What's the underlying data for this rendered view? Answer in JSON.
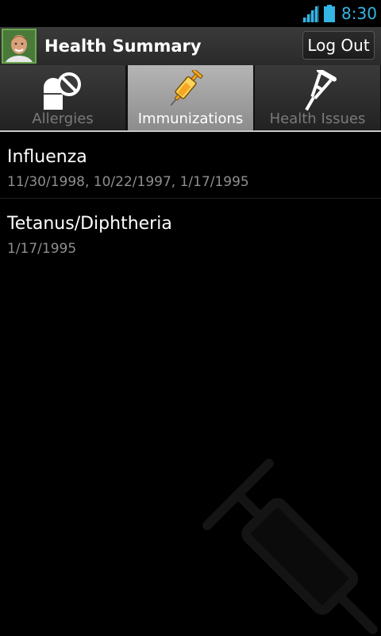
{
  "status_bar": {
    "time": "8:30",
    "icons": [
      "signal-icon",
      "battery-icon"
    ],
    "accent_color": "#33b5e5"
  },
  "header": {
    "title": "Health Summary",
    "logout_label": "Log Out",
    "avatar": "profile-photo"
  },
  "tabs": [
    {
      "label": "Allergies",
      "icon": "pill-icon",
      "selected": false
    },
    {
      "label": "Immunizations",
      "icon": "syringe-icon",
      "selected": true
    },
    {
      "label": "Health Issues",
      "icon": "crutch-icon",
      "selected": false
    }
  ],
  "immunizations": [
    {
      "name": "Influenza",
      "dates": "11/30/1998, 10/22/1997, 1/17/1995"
    },
    {
      "name": "Tetanus/Diphtheria",
      "dates": "1/17/1995"
    }
  ],
  "background_watermark": "syringe-icon"
}
